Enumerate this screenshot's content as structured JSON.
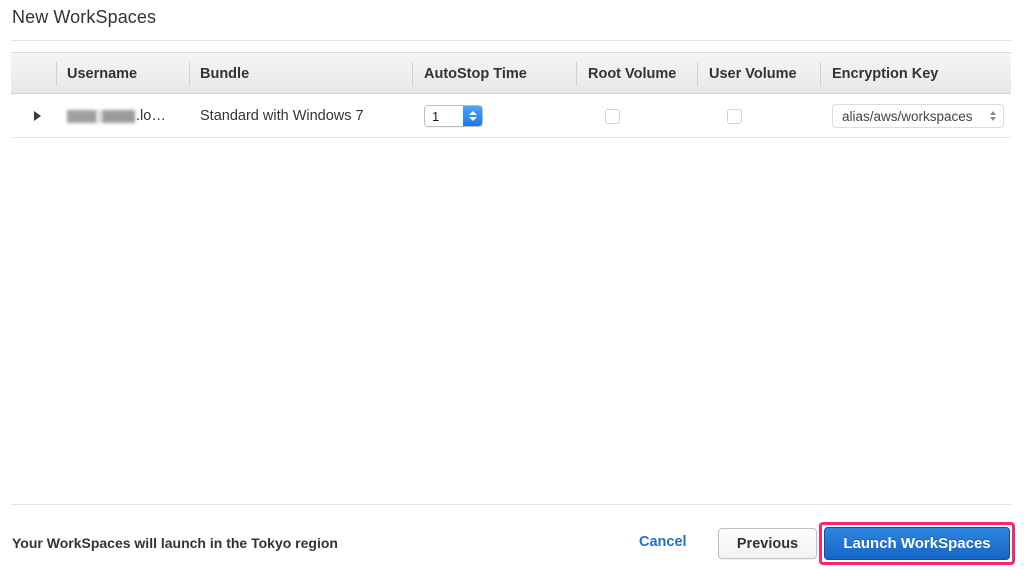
{
  "page": {
    "title": "New WorkSpaces"
  },
  "table": {
    "columns": [
      {
        "key": "expander",
        "label": ""
      },
      {
        "key": "username",
        "label": "Username"
      },
      {
        "key": "bundle",
        "label": "Bundle"
      },
      {
        "key": "autostop",
        "label": "AutoStop Time"
      },
      {
        "key": "root_volume",
        "label": "Root Volume"
      },
      {
        "key": "user_volume",
        "label": "User Volume"
      },
      {
        "key": "encryption",
        "label": "Encryption Key"
      }
    ],
    "rows": [
      {
        "expander_icon": "triangle-right-icon",
        "username": ".lo…",
        "username_redacted": true,
        "bundle": "Standard with Windows 7",
        "autostop_time": "1",
        "root_volume_checked": false,
        "user_volume_checked": false,
        "encryption_key": "alias/aws/workspaces"
      }
    ]
  },
  "footer": {
    "note": "Your WorkSpaces will launch in the Tokyo region",
    "cancel_label": "Cancel",
    "previous_label": "Previous",
    "launch_label": "Launch WorkSpaces"
  },
  "colors": {
    "accent_link": "#1f6fd0",
    "primary_button": "#1565c6",
    "highlight_outline": "#f7286e",
    "header_bg": "#efefef",
    "text": "#333333"
  }
}
